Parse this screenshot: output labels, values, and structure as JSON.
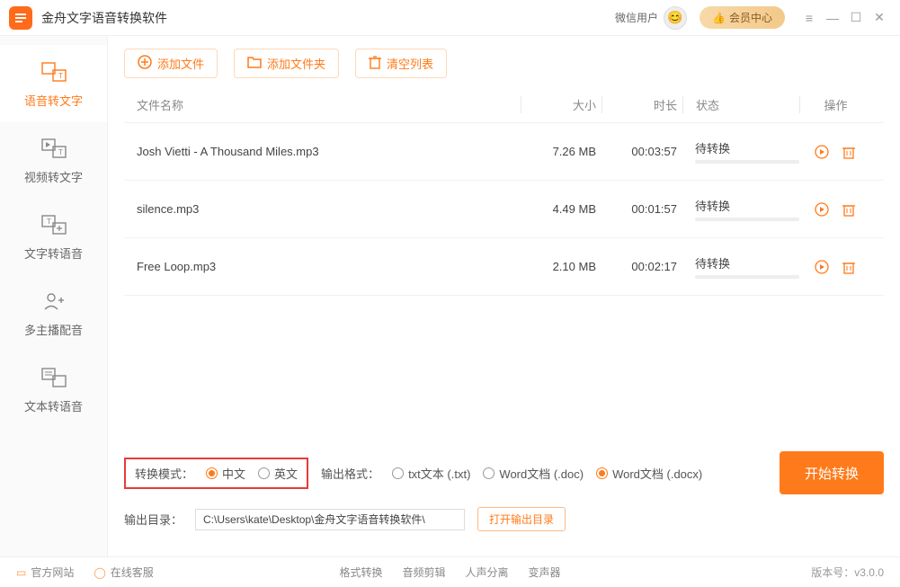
{
  "title_bar": {
    "app_title": "金舟文字语音转换软件",
    "user_label": "微信用户",
    "vip_label": "会员中心"
  },
  "sidebar": {
    "items": [
      {
        "label": "语音转文字"
      },
      {
        "label": "视频转文字"
      },
      {
        "label": "文字转语音"
      },
      {
        "label": "多主播配音"
      },
      {
        "label": "文本转语音"
      }
    ]
  },
  "toolbar": {
    "add_file": "添加文件",
    "add_folder": "添加文件夹",
    "clear_list": "清空列表"
  },
  "table": {
    "headers": {
      "name": "文件名称",
      "size": "大小",
      "duration": "时长",
      "status": "状态",
      "ops": "操作"
    },
    "rows": [
      {
        "name": "Josh Vietti - A Thousand Miles.mp3",
        "size": "7.26 MB",
        "duration": "00:03:57",
        "status": "待转换"
      },
      {
        "name": "silence.mp3",
        "size": "4.49 MB",
        "duration": "00:01:57",
        "status": "待转换"
      },
      {
        "name": "Free Loop.mp3",
        "size": "2.10 MB",
        "duration": "00:02:17",
        "status": "待转换"
      }
    ]
  },
  "options": {
    "mode_label": "转换模式：",
    "mode_cn": "中文",
    "mode_en": "英文",
    "format_label": "输出格式：",
    "fmt_txt": "txt文本 (.txt)",
    "fmt_doc": "Word文档 (.doc)",
    "fmt_docx": "Word文档 (.docx)",
    "output_dir_label": "输出目录：",
    "output_dir_value": "C:\\Users\\kate\\Desktop\\金舟文字语音转换软件\\",
    "open_dir": "打开输出目录",
    "start": "开始转换"
  },
  "footer": {
    "official": "官方网站",
    "support": "在线客服",
    "mid": [
      "格式转换",
      "音频剪辑",
      "人声分离",
      "变声器"
    ],
    "version": "版本号：v3.0.0"
  }
}
